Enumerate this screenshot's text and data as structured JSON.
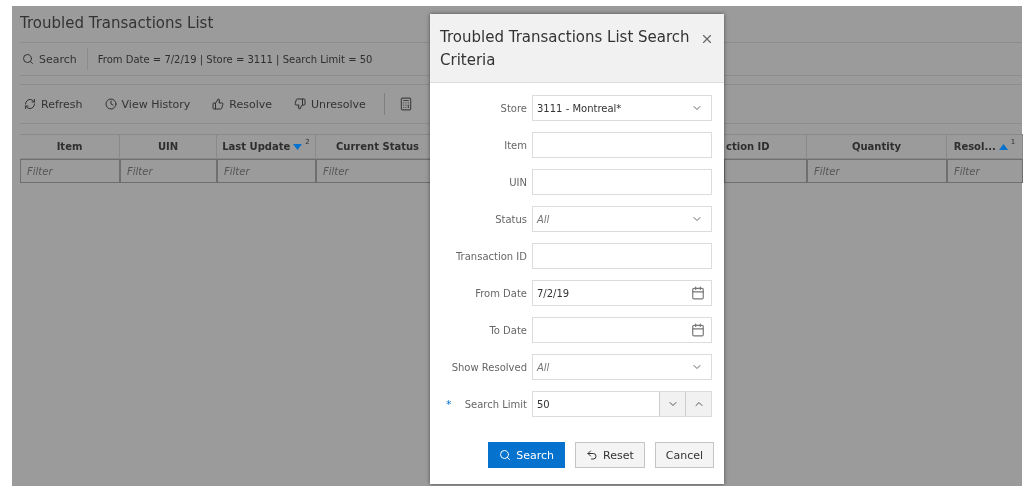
{
  "page": {
    "title": "Troubled Transactions List"
  },
  "search_bar": {
    "button": "Search",
    "criteria": "From Date = 7/2/19 | Store = 3111 | Search Limit = 50"
  },
  "toolbar": [
    {
      "kind": "refresh",
      "label": "Refresh"
    },
    {
      "kind": "history",
      "label": "View History"
    },
    {
      "kind": "resolve",
      "label": "Resolve"
    },
    {
      "kind": "unresolve",
      "label": "Unresolve"
    }
  ],
  "table": {
    "columns": [
      {
        "label": "Item",
        "filter": "Filter",
        "sorted_ascending": false,
        "sorted_descending": false
      },
      {
        "label": "UIN",
        "filter": "Filter",
        "sorted_ascending": false,
        "sorted_descending": false
      },
      {
        "label": "Last Update",
        "filter": "Filter",
        "sorted_ascending": false,
        "sorted_descending": true,
        "sort_rank": "2"
      },
      {
        "label": "Current Status",
        "filter": "Filter",
        "sorted_ascending": false,
        "sorted_descending": false
      },
      {
        "label": "ction ID",
        "sorted_ascending": false,
        "sorted_descending": false
      },
      {
        "label": "Quantity",
        "filter": "Filter",
        "sorted_ascending": false,
        "sorted_descending": false
      },
      {
        "label": "Resol...",
        "filter": "Filter",
        "sorted_ascending": true,
        "sorted_descending": false,
        "sort_rank": "1"
      }
    ]
  },
  "dialog": {
    "title": "Troubled Transactions List Search Criteria",
    "fields": [
      {
        "kind": "select",
        "label": "Store",
        "value": "3111 - Montreal*"
      },
      {
        "kind": "text",
        "label": "Item"
      },
      {
        "kind": "text",
        "label": "UIN"
      },
      {
        "kind": "select",
        "label": "Status",
        "placeholder": "All"
      },
      {
        "kind": "text",
        "label": "Transaction ID"
      },
      {
        "kind": "date",
        "label": "From Date",
        "value": "7/2/19"
      },
      {
        "kind": "date",
        "label": "To Date"
      },
      {
        "kind": "select",
        "label": "Show Resolved",
        "placeholder": "All"
      },
      {
        "kind": "number",
        "label": "Search Limit",
        "value": "50",
        "required": true,
        "required_mark": "*"
      }
    ],
    "buttons": [
      {
        "kind": "primary",
        "label": "Search"
      },
      {
        "kind": "reset",
        "label": "Reset"
      },
      {
        "kind": "plain",
        "label": "Cancel"
      }
    ]
  }
}
